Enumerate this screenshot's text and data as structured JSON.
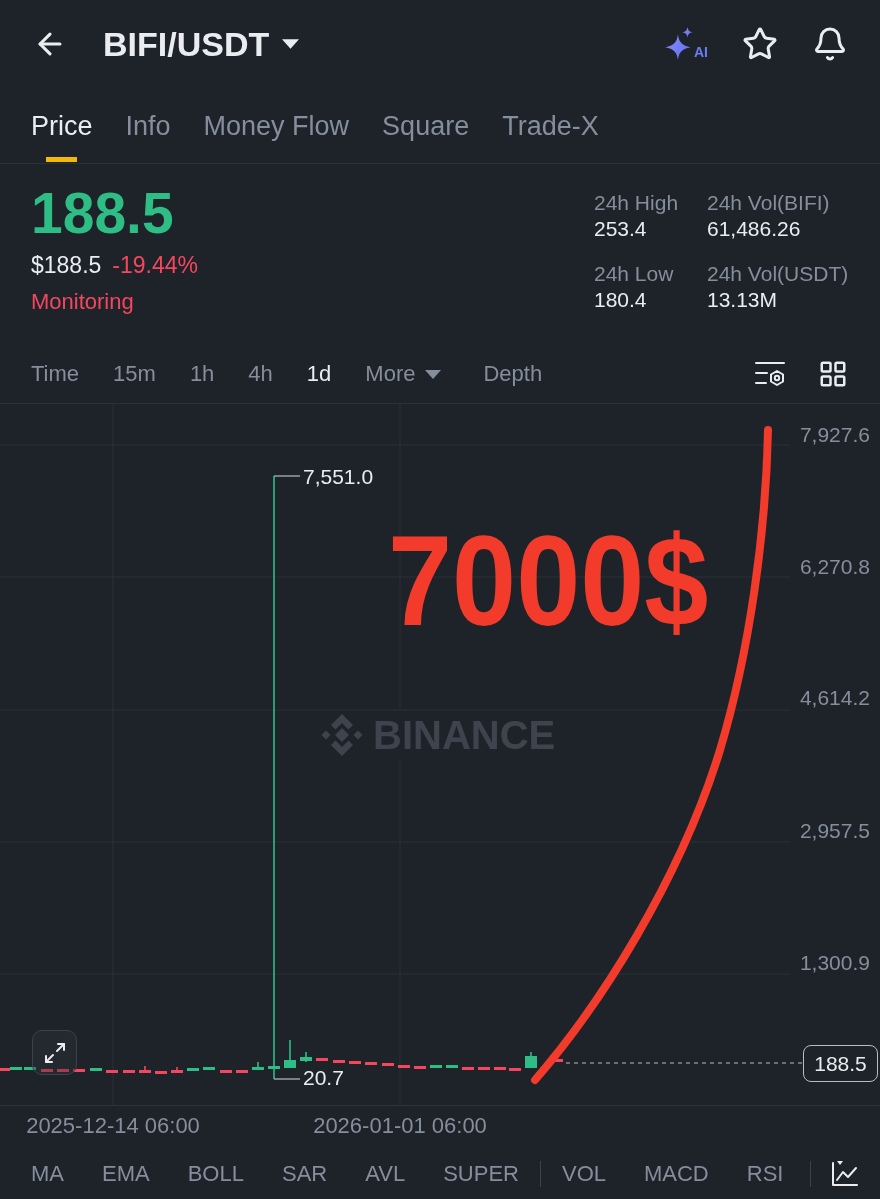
{
  "header": {
    "title": "BIFI/USDT",
    "ai_badge": "AI"
  },
  "tabs": [
    {
      "label": "Price",
      "selected": true
    },
    {
      "label": "Info",
      "selected": false
    },
    {
      "label": "Money Flow",
      "selected": false
    },
    {
      "label": "Square",
      "selected": false
    },
    {
      "label": "Trade-X",
      "selected": false
    }
  ],
  "ticker": {
    "last_price": "188.5",
    "last_price_up": true,
    "fiat_price": "$188.5",
    "change": "-19.44%",
    "change_up": false,
    "status": "Monitoring"
  },
  "stats": [
    {
      "label": "24h High",
      "value": "253.4"
    },
    {
      "label": "24h Vol(BIFI)",
      "value": "61,486.26"
    },
    {
      "label": "24h Low",
      "value": "180.4"
    },
    {
      "label": "24h Vol(USDT)",
      "value": "13.13M"
    }
  ],
  "intervals": [
    {
      "label": "Time",
      "kind": "interval",
      "selected": false
    },
    {
      "label": "15m",
      "kind": "interval",
      "selected": false
    },
    {
      "label": "1h",
      "kind": "interval",
      "selected": false
    },
    {
      "label": "4h",
      "kind": "interval",
      "selected": false
    },
    {
      "label": "1d",
      "kind": "interval",
      "selected": true
    },
    {
      "label": "More",
      "kind": "dropdown",
      "selected": false
    },
    {
      "label": "Depth",
      "kind": "view",
      "selected": false
    }
  ],
  "chart": {
    "watermark": "BINANCE",
    "y_axis": [
      "7,927.6",
      "6,270.8",
      "4,614.2",
      "2,957.5",
      "1,300.9"
    ],
    "high_label": "7,551.0",
    "low_label": "20.7",
    "last_price": "188.5",
    "annotation": "7000$",
    "x_axis": [
      "2025-12-14 06:00",
      "2026-01-01 06:00"
    ]
  },
  "indicators": {
    "main": [
      "MA",
      "EMA",
      "BOLL",
      "SAR",
      "AVL",
      "SUPER"
    ],
    "sub": [
      "VOL",
      "MACD",
      "RSI"
    ]
  }
}
